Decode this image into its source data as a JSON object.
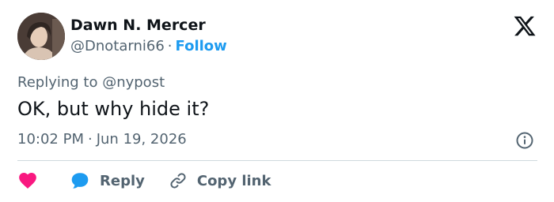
{
  "author": {
    "display_name": "Dawn N. Mercer",
    "handle": "@Dnotarni66",
    "separator": "·",
    "follow_label": "Follow"
  },
  "reply_context": "Replying to @nypost",
  "tweet": {
    "text": "OK, but why hide it?",
    "time": "10:02 PM",
    "separator": "·",
    "date": "Jun 19, 2026"
  },
  "actions": {
    "reply_label": "Reply",
    "copy_link_label": "Copy link"
  },
  "icons": {
    "logo": "x-logo-icon",
    "info": "info-icon",
    "like": "heart-icon",
    "reply": "speech-bubble-icon",
    "copy": "link-icon"
  },
  "colors": {
    "accent": "#1d9bf0",
    "like": "#f91880",
    "muted": "#536471",
    "text": "#0f1419"
  }
}
